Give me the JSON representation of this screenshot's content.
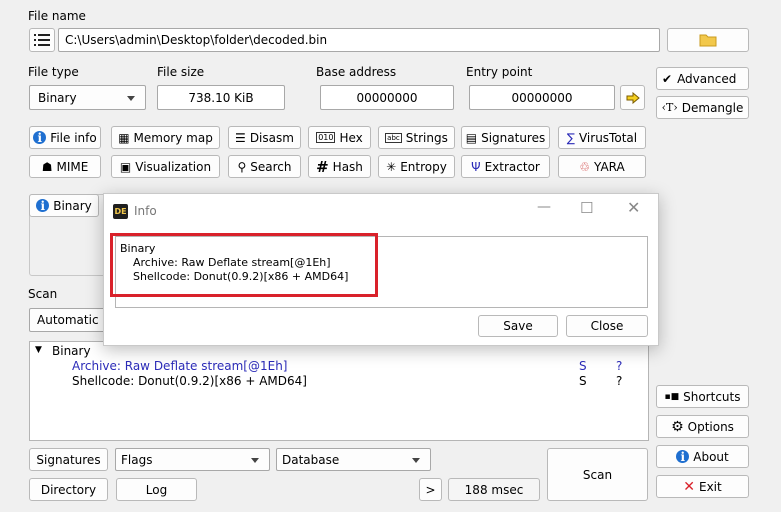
{
  "file_name": {
    "label": "File name",
    "path": "C:\\Users\\admin\\Desktop\\folder\\decoded.bin"
  },
  "file_type": {
    "label": "File type",
    "value": "Binary"
  },
  "file_size": {
    "label": "File size",
    "value": "738.10 KiB"
  },
  "base_address": {
    "label": "Base address",
    "value": "00000000"
  },
  "entry_point": {
    "label": "Entry point",
    "value": "00000000"
  },
  "right_panel": {
    "advanced_label": "Advanced",
    "advanced_checked": true,
    "demangle_label": "Demangle",
    "shortcuts_label": "Shortcuts",
    "options_label": "Options",
    "about_label": "About",
    "exit_label": "Exit"
  },
  "toolbar_row1": [
    "File info",
    "Memory map",
    "Disasm",
    "Hex",
    "Strings",
    "Signatures",
    "VirusTotal"
  ],
  "toolbar_row2": [
    "MIME",
    "Visualization",
    "Search",
    "Hash",
    "Entropy",
    "Extractor",
    "YARA"
  ],
  "binary_tab": "Binary",
  "scan": {
    "label": "Scan",
    "mode": "Automatic",
    "tree": {
      "root": "Binary",
      "items": [
        {
          "text": "Archive: Raw Deflate stream[@1Eh]",
          "col1": "S",
          "col2": "?",
          "highlighted": true
        },
        {
          "text": "Shellcode: Donut(0.9.2)[x86 + AMD64]",
          "col1": "S",
          "col2": "?",
          "highlighted": false
        }
      ]
    }
  },
  "bottom": {
    "signatures": "Signatures",
    "flags": "Flags",
    "database": "Database",
    "directory": "Directory",
    "log": "Log",
    "arrow": ">",
    "time": "188 msec",
    "scan_button": "Scan"
  },
  "dialog": {
    "title": "Info",
    "line1": "Binary",
    "line2": "Archive: Raw Deflate stream[@1Eh]",
    "line3": "Shellcode: Donut(0.9.2)[x86 + AMD64]",
    "save": "Save",
    "close": "Close",
    "highlight_color": "#d9212a"
  },
  "colors": {
    "accent_blue": "#2b2bb8",
    "highlight_red": "#d9212a",
    "folder_yellow": "#f2c84b"
  }
}
